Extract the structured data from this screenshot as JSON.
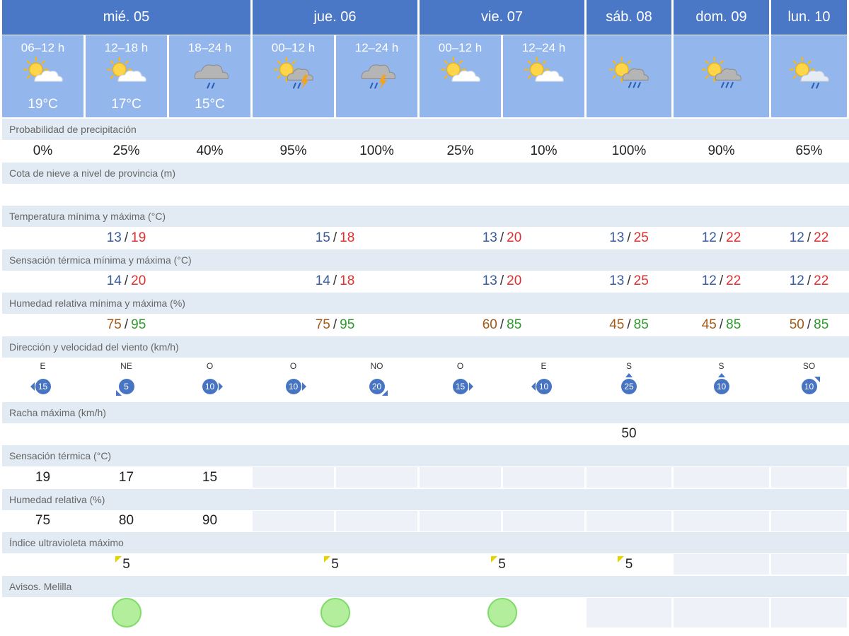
{
  "days": [
    {
      "label": "mié. 05"
    },
    {
      "label": "jue. 06"
    },
    {
      "label": "vie. 07"
    },
    {
      "label": "sáb. 08"
    },
    {
      "label": "dom. 09"
    },
    {
      "label": "lun. 10"
    }
  ],
  "periods": [
    {
      "label": "06–12 h",
      "temp": "19°C",
      "icon": "sun-cloud-icon"
    },
    {
      "label": "12–18 h",
      "temp": "17°C",
      "icon": "sun-cloud-icon"
    },
    {
      "label": "18–24 h",
      "temp": "15°C",
      "icon": "cloud-rain-icon"
    },
    {
      "label": "00–12 h",
      "temp": "",
      "icon": "sun-cloud-storm-icon"
    },
    {
      "label": "12–24 h",
      "temp": "",
      "icon": "cloud-storm-icon"
    },
    {
      "label": "00–12 h",
      "temp": "",
      "icon": "sun-cloud-icon"
    },
    {
      "label": "12–24 h",
      "temp": "",
      "icon": "sun-cloud-icon"
    },
    {
      "label": "",
      "temp": "",
      "icon": "sun-cloud-rain-icon"
    },
    {
      "label": "",
      "temp": "",
      "icon": "sun-cloud-rain-icon"
    },
    {
      "label": "",
      "temp": "",
      "icon": "sun-cloud-light-rain-icon"
    }
  ],
  "labels": {
    "precip": "Probabilidad de precipitación",
    "snow": "Cota de nieve a nivel de provincia (m)",
    "temp": "Temperatura mínima y máxima (°C)",
    "sens": "Sensación térmica mínima y máxima (°C)",
    "hum": "Humedad relativa mínima y máxima (%)",
    "wind": "Dirección y velocidad del viento (km/h)",
    "gust": "Racha máxima (km/h)",
    "sens_period": "Sensación térmica (°C)",
    "hum_period": "Humedad relativa (%)",
    "uv": "Índice ultravioleta máximo",
    "avisos": "Avisos. Melilla"
  },
  "precip": [
    "0%",
    "25%",
    "40%",
    "95%",
    "100%",
    "25%",
    "10%",
    "100%",
    "90%",
    "65%"
  ],
  "snow": [
    "",
    "",
    "",
    "",
    "",
    "",
    "",
    "",
    "",
    ""
  ],
  "temp_minmax": [
    {
      "min": "13",
      "max": "19"
    },
    {
      "min": "15",
      "max": "18"
    },
    {
      "min": "13",
      "max": "20"
    },
    {
      "min": "13",
      "max": "25"
    },
    {
      "min": "12",
      "max": "22"
    },
    {
      "min": "12",
      "max": "22"
    }
  ],
  "sens_minmax": [
    {
      "min": "14",
      "max": "20"
    },
    {
      "min": "14",
      "max": "18"
    },
    {
      "min": "13",
      "max": "20"
    },
    {
      "min": "13",
      "max": "25"
    },
    {
      "min": "12",
      "max": "22"
    },
    {
      "min": "12",
      "max": "22"
    }
  ],
  "hum_minmax": [
    {
      "min": "75",
      "max": "95"
    },
    {
      "min": "75",
      "max": "95"
    },
    {
      "min": "60",
      "max": "85"
    },
    {
      "min": "45",
      "max": "85"
    },
    {
      "min": "45",
      "max": "85"
    },
    {
      "min": "50",
      "max": "85"
    }
  ],
  "wind": [
    {
      "dir": "E",
      "speed": "15"
    },
    {
      "dir": "NE",
      "speed": "5"
    },
    {
      "dir": "O",
      "speed": "10"
    },
    {
      "dir": "O",
      "speed": "10"
    },
    {
      "dir": "NO",
      "speed": "20"
    },
    {
      "dir": "O",
      "speed": "15"
    },
    {
      "dir": "E",
      "speed": "10"
    },
    {
      "dir": "S",
      "speed": "25"
    },
    {
      "dir": "S",
      "speed": "10"
    },
    {
      "dir": "SO",
      "speed": "10"
    }
  ],
  "gust": [
    "",
    "",
    "",
    "",
    "",
    "",
    "",
    "50",
    "",
    ""
  ],
  "sens_period": [
    "19",
    "17",
    "15"
  ],
  "hum_period": [
    "75",
    "80",
    "90"
  ],
  "uv": [
    "5",
    "5",
    "5",
    "5",
    "",
    ""
  ],
  "avisos": [
    {
      "level": "green",
      "color": "#b2ee9c"
    },
    {
      "level": "green",
      "color": "#b2ee9c"
    },
    {
      "level": "green",
      "color": "#b2ee9c"
    },
    {
      "level": "",
      "color": ""
    },
    {
      "level": "",
      "color": ""
    },
    {
      "level": "",
      "color": ""
    }
  ],
  "colors": {
    "day_header": "#4b78c6",
    "period_header": "#93b6ec",
    "label_row": "#e2ebf3",
    "temp_min": "#3b5d9b",
    "temp_max": "#e03030",
    "hum_min": "#a35a18",
    "hum_max": "#2e9a2e",
    "wind_badge": "#4775c4",
    "uv_flag": "#e6d400"
  }
}
